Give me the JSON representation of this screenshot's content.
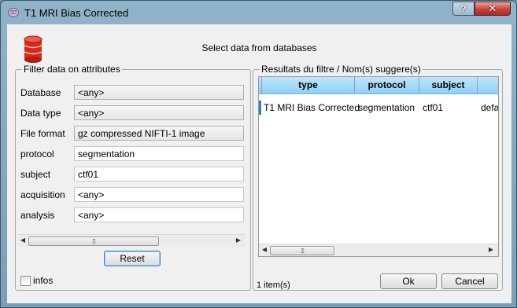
{
  "window": {
    "title": "T1 MRI Bias Corrected",
    "help_label": "?",
    "close_label": "✕"
  },
  "header": {
    "text": "Select data from databases"
  },
  "filter": {
    "group_title": "Filter data on attributes",
    "fields": [
      {
        "label": "Database",
        "value": "<any>",
        "kind": "combo"
      },
      {
        "label": "Data type",
        "value": "<any>",
        "kind": "combo"
      },
      {
        "label": "File format",
        "value": "gz compressed NIFTI-1 image",
        "kind": "combo"
      },
      {
        "label": "protocol",
        "value": "segmentation",
        "kind": "text"
      },
      {
        "label": "subject",
        "value": "ctf01",
        "kind": "text"
      },
      {
        "label": "acquisition",
        "value": "<any>",
        "kind": "text"
      },
      {
        "label": "analysis",
        "value": "<any>",
        "kind": "text"
      }
    ],
    "reset_label": "Reset"
  },
  "results": {
    "group_title": "Resultats du filtre / Nom(s) suggere(s)",
    "columns": [
      "type",
      "protocol",
      "subject"
    ],
    "rows": [
      [
        "T1 MRI Bias Corrected",
        "segmentation",
        "ctf01",
        "defa"
      ]
    ],
    "count_label": "1 item(s)"
  },
  "footer": {
    "infos_label": "infos",
    "infos_checked": false,
    "ok_label": "Ok",
    "cancel_label": "Cancel"
  },
  "colors": {
    "header_row": "#8fd0f5",
    "close_button": "#c7423a",
    "selection_marker": "#2e7fc0"
  },
  "icons": [
    "brainvisa-icon",
    "database-icon",
    "help-icon",
    "close-icon",
    "scroll-left-icon",
    "scroll-right-icon"
  ]
}
